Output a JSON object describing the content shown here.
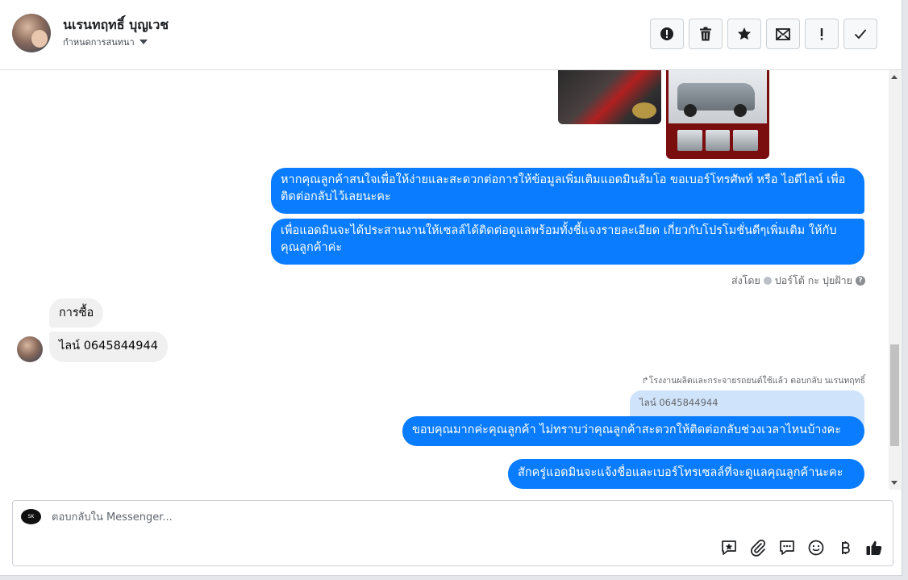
{
  "header": {
    "contact_name": "นเรนทฤทธิ์ บุญเวช",
    "set_nickname": "กำหนดการสนทนา",
    "toolbar_icons": [
      "alert-circle-icon",
      "trash-icon",
      "star-icon",
      "envelope-icon",
      "exclamation-icon",
      "check-icon"
    ]
  },
  "messages": {
    "out_1": "หากคุณลูกค้าสนใจเพื่อให้ง่ายและสะดวกต่อการให้ข้อมูลเพิ่มเติมแอดมินส้มโอ ขอเบอร์โทรศัพท์ หรือ ไอดีไลน์ เพื่อติดต่อกลับไว้เลยนะคะ",
    "out_2": "เพื่อแอดมินจะได้ประสานงานให้เซลล์ได้ติดต่อดูแลพร้อมทั้งชี้แจงรายละเอียด เกี่ยวกับโปรโมชั่นดีๆเพิ่มเติม ให้กับคุณลูกค้าค่ะ",
    "sent_by_label": "ส่งโดย",
    "sent_by_name": "ปอร์โต้ กะ ปุยฝ้าย",
    "in_1": "การซื้อ",
    "in_2": "ไลน์ 0645844944",
    "reply_meta": "↱โรงงานผลิตและกระจายรถยนต์ใช้แล้ว ตอบกลับ นเรนทฤทธิ์",
    "quoted_text": "ไลน์ 0645844944",
    "out_3": "ขอบคุณมากค่ะคุณลูกค้า ไม่ทราบว่าคุณลูกค้าสะดวกให้ติดต่อกลับช่วงเวลาไหนบ้างคะ",
    "out_4": "สักครู่แอดมินจะแจ้งชื่อและเบอร์โทรเซลล์ที่จะดูแลคุณลูกค้านะคะ"
  },
  "composer": {
    "placeholder": "ตอบกลับใน Messenger...",
    "page_avatar_text": "SK",
    "icons": [
      "saved-reply-icon",
      "attachment-icon",
      "chat-bubble-icon",
      "emoji-icon",
      "baht-icon",
      "thumbs-up-icon"
    ]
  },
  "colors": {
    "outgoing_bubble": "#0a7cff",
    "incoming_bubble": "#f0f0f0",
    "quoted_bubble": "#cfe3fb"
  }
}
